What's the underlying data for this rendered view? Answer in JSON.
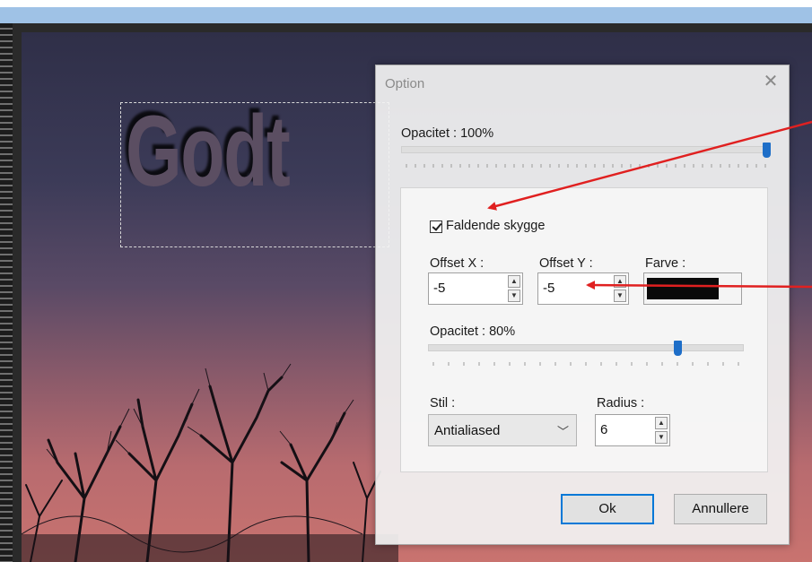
{
  "canvas": {
    "text": "Godt"
  },
  "dialog": {
    "title": "Option",
    "close_glyph": "✕",
    "opacity_label": "Opacitet : 100%",
    "opacity_value": 100,
    "drop_shadow": {
      "checkbox_label": "Faldende skygge",
      "checked": true,
      "offset_x_label": "Offset X :",
      "offset_x_value": "-5",
      "offset_y_label": "Offset Y :",
      "offset_y_value": "-5",
      "color_label": "Farve :",
      "color_value": "#0a0a0a",
      "opacity_label": "Opacitet : 80%",
      "opacity_value": 80,
      "style_label": "Stil :",
      "style_value": "Antialiased",
      "radius_label": "Radius :",
      "radius_value": "6"
    },
    "ok_label": "Ok",
    "cancel_label": "Annullere"
  },
  "icons": {
    "close": "close-icon",
    "spin_up": "spin-up-icon",
    "spin_down": "spin-down-icon",
    "dropdown": "chevron-down-icon",
    "check": "checkmark-icon"
  },
  "colors": {
    "accent": "#1e6ec8",
    "annotation_arrow": "#e02020",
    "shadow_color": "#0a0a0a"
  }
}
